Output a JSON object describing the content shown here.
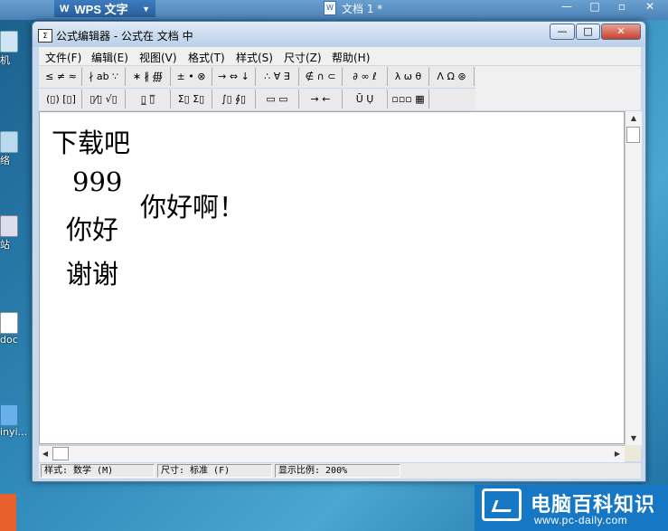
{
  "background_app": {
    "tab_label": "WPS 文字",
    "doc_title": "文档 1 *"
  },
  "desktop_icons": [
    "机",
    "络",
    "站",
    "doc",
    "inyi..."
  ],
  "window": {
    "title": "公式编辑器 - 公式在 文档 中",
    "controls": {
      "minimize": "—",
      "maximize": "□",
      "close": "✕"
    }
  },
  "menu": [
    "文件(F)",
    "编辑(E)",
    "视图(V)",
    "格式(T)",
    "样式(S)",
    "尺寸(Z)",
    "帮助(H)"
  ],
  "toolbar_row1": [
    "≤ ≠ ≈",
    "∤ ab ∵",
    "∗ ∦ ∰",
    "± • ⊗",
    "→ ⇔ ↓",
    "∴ ∀ ∃",
    "∉ ∩ ⊂",
    "∂ ∞ ℓ",
    "λ ω θ",
    "Λ Ω ⊛"
  ],
  "toolbar_row2": [
    "(▯) [▯]",
    "▯⁄▯ √▯",
    "▯̲ ▯̅",
    "Σ▯ Σ▯",
    "∫▯ ∮▯",
    "▭ ▭",
    "→ ←",
    "Ū Ụ",
    "▫▫▫ ▦"
  ],
  "formula": {
    "lines": [
      "下载吧",
      "999",
      "你好",
      "谢谢"
    ],
    "side": "你好啊！"
  },
  "status": {
    "style": "样式: 数学 (M)",
    "size": "尺寸: 标准 (F)",
    "zoom": "显示比例: 200%"
  },
  "watermark": {
    "title": "电脑百科知识",
    "url": "www.pc-daily.com"
  }
}
